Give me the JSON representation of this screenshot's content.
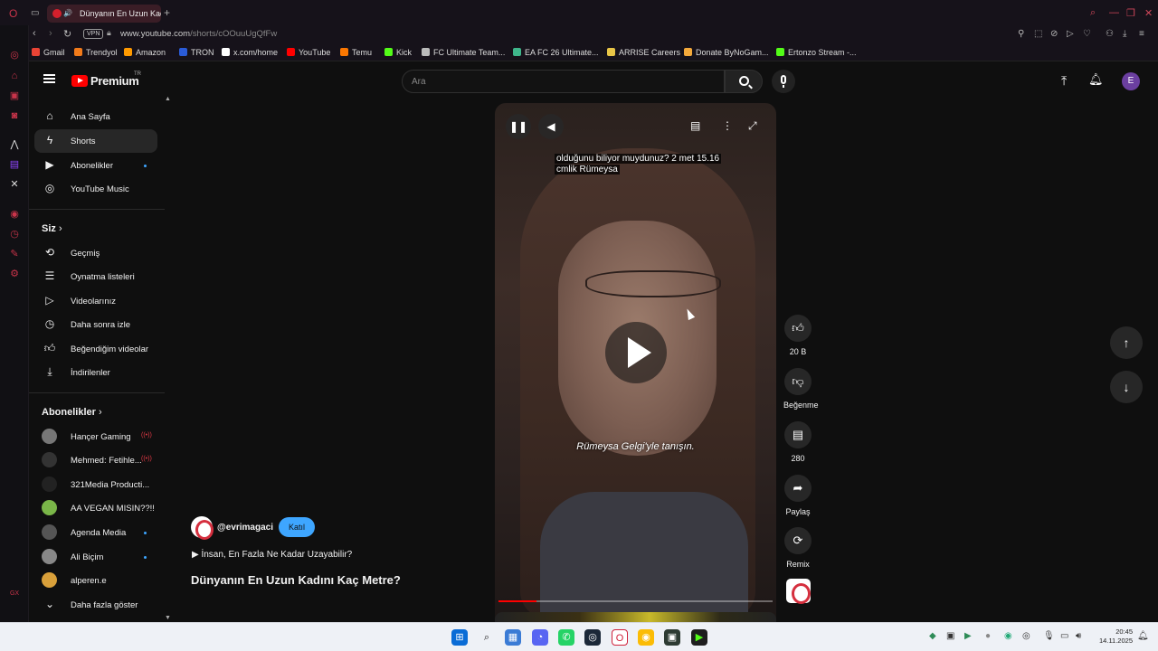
{
  "browser": {
    "tab_title": "Dünyanın En Uzun Kad",
    "url_host": "www.youtube.com",
    "url_path": "/shorts/cOOuuUgQfFw",
    "vpn_label": "VPN",
    "bookmarks": [
      {
        "label": "Gmail",
        "color": "#ea4335"
      },
      {
        "label": "Trendyol",
        "color": "#f27a1a"
      },
      {
        "label": "Amazon",
        "color": "#ff9900"
      },
      {
        "label": "TRON",
        "color": "#2a5bd7"
      },
      {
        "label": "x.com/home",
        "color": "#ffffff"
      },
      {
        "label": "YouTube",
        "color": "#ff0000"
      },
      {
        "label": "Temu",
        "color": "#fb7701"
      },
      {
        "label": "Kick",
        "color": "#53fc18"
      },
      {
        "label": "FC Ultimate Team...",
        "color": "#bbbbbb"
      },
      {
        "label": "EA FC 26 Ultimate...",
        "color": "#3fb68b"
      },
      {
        "label": "ARRISE Careers",
        "color": "#e8c547"
      },
      {
        "label": "Donate ByNoGam...",
        "color": "#f4a93b"
      },
      {
        "label": "Ertonzo Stream -...",
        "color": "#53fc18"
      }
    ]
  },
  "youtube": {
    "logo_text": "Premium",
    "logo_country": "TR",
    "search_placeholder": "Ara",
    "avatar_letter": "E",
    "accent": "#3ea6ff",
    "brand": "#ff0000"
  },
  "sidebar": {
    "main": [
      {
        "label": "Ana Sayfa",
        "icon": "home-icon"
      },
      {
        "label": "Shorts",
        "icon": "shorts-icon"
      },
      {
        "label": "Abonelikler",
        "icon": "subscriptions-icon"
      },
      {
        "label": "YouTube Music",
        "icon": "music-icon"
      }
    ],
    "you_heading": "Siz",
    "you": [
      {
        "label": "Geçmiş",
        "icon": "history-icon"
      },
      {
        "label": "Oynatma listeleri",
        "icon": "playlists-icon"
      },
      {
        "label": "Videolarınız",
        "icon": "your-videos-icon"
      },
      {
        "label": "Daha sonra izle",
        "icon": "watch-later-icon"
      },
      {
        "label": "Beğendiğim videolar",
        "icon": "liked-icon"
      },
      {
        "label": "İndirilenler",
        "icon": "downloads-icon"
      }
    ],
    "subs_heading": "Abonelikler",
    "subs": [
      {
        "label": "Hançer Gaming",
        "live": true,
        "color": "#777777"
      },
      {
        "label": "Mehmed: Fetihle...",
        "live": true,
        "color": "#333333"
      },
      {
        "label": "321Media Producti...",
        "live": false,
        "color": "#222222"
      },
      {
        "label": "AA VEGAN MISIN??!!",
        "live": false,
        "color": "#7ab648"
      },
      {
        "label": "Agenda Media",
        "live": false,
        "color": "#555555"
      },
      {
        "label": "Ali Biçim",
        "live": false,
        "color": "#888888"
      },
      {
        "label": "alperen.e",
        "live": false,
        "color": "#d9a03a"
      }
    ],
    "show_more": "Daha fazla göster"
  },
  "video": {
    "caption_line1": "olduğunu biliyor muydunuz? 2 met 15.16",
    "caption_line2": "cmlik Rümeysa",
    "subtitle": "Rümeysa Gelgi'yle tanışın.",
    "progress": 0.14
  },
  "actions": {
    "likes": "20 B",
    "dislike": "Beğenme",
    "comments": "280",
    "share": "Paylaş",
    "remix": "Remix"
  },
  "channel": {
    "handle": "@evrimagaci",
    "join": "Katıl",
    "playlist": "İnsan, En Fazla Ne Kadar Uzayabilir?",
    "title": "Dünyanın En Uzun Kadını Kaç Metre?"
  },
  "clock": {
    "time": "20:45",
    "date": "14.11.2025"
  }
}
